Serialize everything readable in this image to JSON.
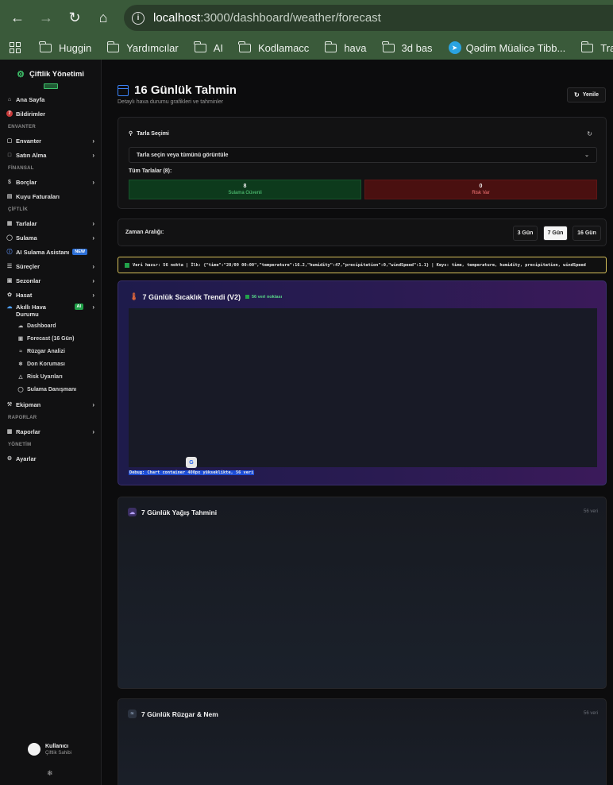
{
  "browser": {
    "url_host": "localhost",
    "url_path": ":3000/dashboard/weather/forecast",
    "bookmarks": [
      "Huggin",
      "Yardımcılar",
      "AI",
      "Kodlamacc",
      "hava",
      "3d bas",
      "Qədim Müalicə Tibb...",
      "Tradin"
    ]
  },
  "sidebar": {
    "brand": "Çiftlik Yönetimi",
    "home": "Ana Sayfa",
    "notifications": "Bildirimler",
    "notifications_count": "7",
    "sections": {
      "inventory": "ENVANTER",
      "finance": "FİNANSAL",
      "farm": "ÇİFTLİK",
      "reports": "RAPORLAR",
      "admin": "YÖNETİM"
    },
    "items": {
      "inventory": "Envanter",
      "purchase": "Satın Alma",
      "debts": "Borçlar",
      "well_invoices": "Kuyu Faturaları",
      "fields": "Tarlalar",
      "irrigation": "Sulama",
      "ai_assistant": "AI Sulama Asistanı",
      "new_badge": "NEW",
      "processes": "Süreçler",
      "seasons": "Sezonlar",
      "harvest": "Hasat",
      "smart_weather": "Akıllı Hava Durumu",
      "ai_badge": "AI",
      "equipment": "Ekipman",
      "reports": "Raporlar",
      "settings": "Ayarlar"
    },
    "weather_sub": [
      "Dashboard",
      "Forecast (16 Gün)",
      "Rüzgar Analizi",
      "Don Koruması",
      "Risk Uyarıları",
      "Sulama Danışmanı"
    ],
    "user": {
      "name": "Kullanıcı",
      "role": "Çiftlik Sahibi"
    }
  },
  "header": {
    "title": "16 Günlük Tahmin",
    "subtitle": "Detaylı hava durumu grafikleri ve tahminler",
    "refresh": "Yenile"
  },
  "field_select": {
    "title": "Tarla Seçimi",
    "placeholder": "Tarla seçin veya tümünü görüntüle",
    "all_fields": "Tüm Tarlalar (8):",
    "safe_count": "8",
    "safe_label": "Sulama Güvenli",
    "risk_count": "0",
    "risk_label": "Risk Var"
  },
  "time_range": {
    "label": "Zaman Aralığı:",
    "options": [
      "3 Gün",
      "7 Gün",
      "16 Gün"
    ],
    "selected": "7 Gün"
  },
  "debug_bar": "Veri hazır: 56 nokta | İlk: {\"time\":\"28/09 00:00\",\"temperature\":16.2,\"humidity\":47,\"precipitation\":0,\"windSpeed\":1.1} | Keys: time, temperature, humidity, precipitation, windSpeed",
  "temp_chart": {
    "title": "7 Günlük Sıcaklık Trendi (V2)",
    "points": "56 veri noktası",
    "debug": "Debug: Chart container 400px yükseklikte, 56 veri"
  },
  "rain_chart": {
    "title": "7 Günlük Yağış Tahmini",
    "count": "56 veri"
  },
  "wind_chart": {
    "title": "7 Günlük Rüzgar & Nem",
    "count": "56 veri"
  }
}
